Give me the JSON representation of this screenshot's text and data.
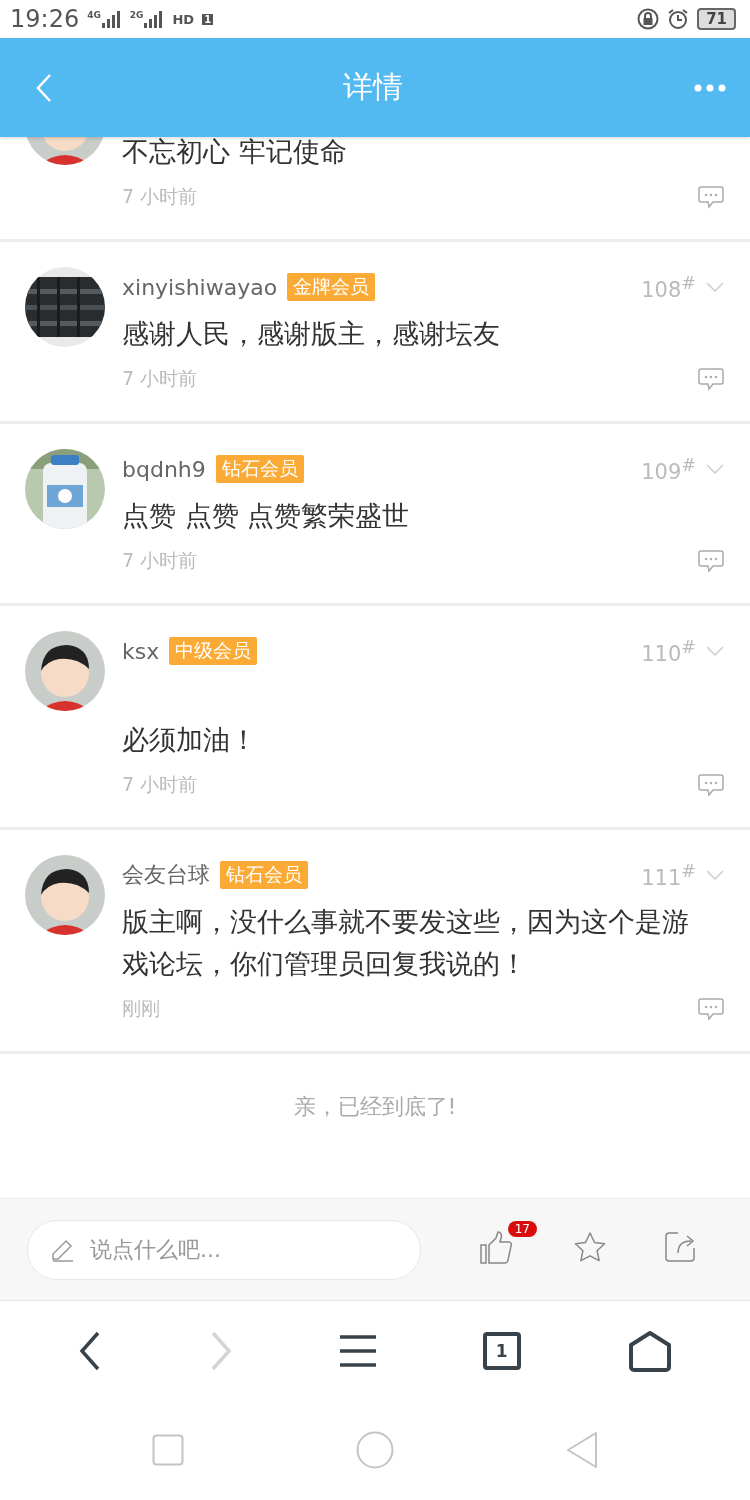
{
  "status_bar": {
    "time": "19:26",
    "signals": [
      {
        "label": "4G"
      },
      {
        "label": "2G"
      }
    ],
    "hd_label": "HD",
    "hd_slot": "1",
    "battery": "71"
  },
  "header": {
    "title": "详情"
  },
  "posts": [
    {
      "avatar": {
        "kind": "figure"
      },
      "body": "不忘初心 牢记使命",
      "time": "7 小时前"
    },
    {
      "avatar": {
        "kind": "dark-photo"
      },
      "username": "xinyishiwayao",
      "badge": "金牌会员",
      "floor": "108$^{#}$",
      "body": "感谢人民，感谢版主，感谢坛友",
      "time": "7 小时前"
    },
    {
      "avatar": {
        "kind": "bottle-photo"
      },
      "username": "bqdnh9",
      "badge": "钻石会员",
      "floor": "109$^{#}$",
      "body": "点赞 点赞 点赞繁荣盛世",
      "time": "7 小时前"
    },
    {
      "avatar": {
        "kind": "figure"
      },
      "username": "ksx",
      "badge": "中级会员",
      "floor": "110$^{#}$",
      "body": "\n必须加油！",
      "time": "7 小时前"
    },
    {
      "avatar": {
        "kind": "figure"
      },
      "username": "会友台球",
      "badge": "钻石会员",
      "floor": "111$^{#}$",
      "body": "版主啊，没什么事就不要发这些，因为这个是游戏论坛，你们管理员回复我说的！",
      "time": "刚刚"
    }
  ],
  "end_notice": "亲，已经到底了!",
  "comment_bar": {
    "placeholder": "说点什么吧...",
    "like_count": "17"
  },
  "browser_nav": {
    "forward": {
      "disabled": true
    },
    "tab_count": "1"
  }
}
